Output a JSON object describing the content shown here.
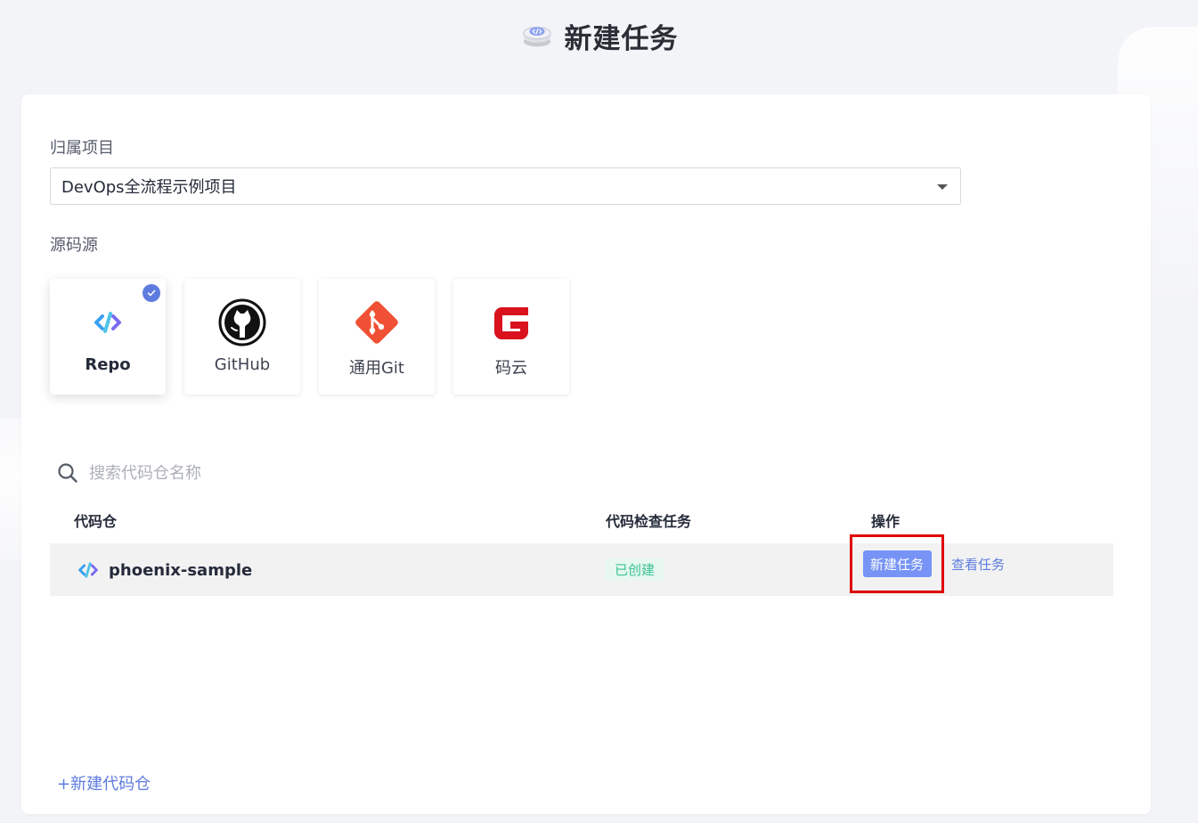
{
  "header": {
    "title": "新建任务",
    "icon": "code-disk-icon"
  },
  "form": {
    "project_label": "归属项目",
    "project_value": "DevOps全流程示例项目",
    "source_label": "源码源"
  },
  "sources": [
    {
      "name": "Repo",
      "icon": "repo-icon",
      "selected": true
    },
    {
      "name": "GitHub",
      "icon": "github-icon",
      "selected": false
    },
    {
      "name": "通用Git",
      "icon": "git-icon",
      "selected": false
    },
    {
      "name": "码云",
      "icon": "gitee-icon",
      "selected": false
    }
  ],
  "search": {
    "placeholder": "搜索代码仓名称"
  },
  "table": {
    "headers": [
      "代码仓",
      "代码检查任务",
      "操作"
    ],
    "rows": [
      {
        "repo": "phoenix-sample",
        "status": "已创建",
        "actions": {
          "primary": "新建任务",
          "secondary": "查看任务"
        }
      }
    ]
  },
  "footer": {
    "new_repo": "+新建代码仓"
  },
  "colors": {
    "accent": "#5e7ce0",
    "button": "#7693f5",
    "success": "#3ac295",
    "highlight": "#e00000"
  }
}
